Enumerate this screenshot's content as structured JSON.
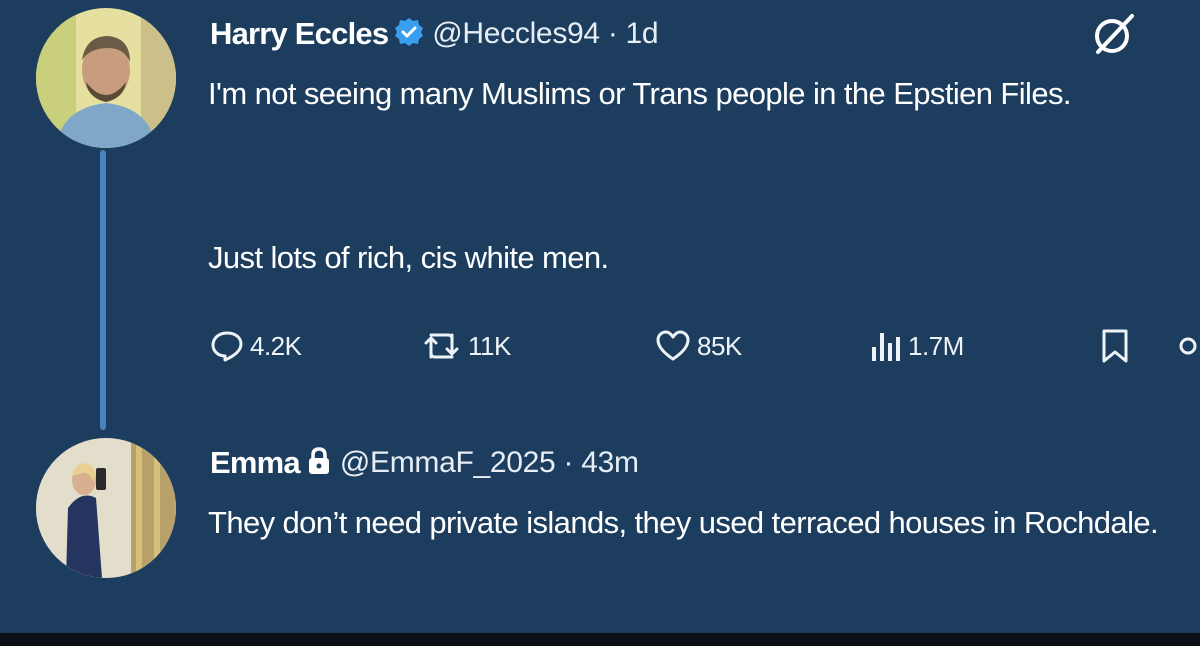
{
  "tweet1": {
    "name": "Harry Eccles",
    "handle_time": "@Heccles94 · 1d",
    "line1": "I'm not seeing many Muslims or Trans people in the Epstien Files.",
    "line2": "Just lots of rich, cis white men.",
    "replies": "4.2K",
    "reposts": "11K",
    "likes": "85K",
    "views": "1.7M"
  },
  "tweet2": {
    "name": "Emma",
    "handle_time": "@EmmaF_2025 · 43m",
    "text": "They don’t need private islands, they used terraced houses in Rochdale."
  },
  "icons": [
    "verified-badge-icon",
    "lock-icon",
    "grok-icon",
    "reply-icon",
    "repost-icon",
    "like-icon",
    "views-icon",
    "bookmark-icon",
    "share-icon"
  ],
  "colors": {
    "background": "#1c3d5e",
    "thread_line": "#4a83bd",
    "verified": "#3a9ef0"
  }
}
